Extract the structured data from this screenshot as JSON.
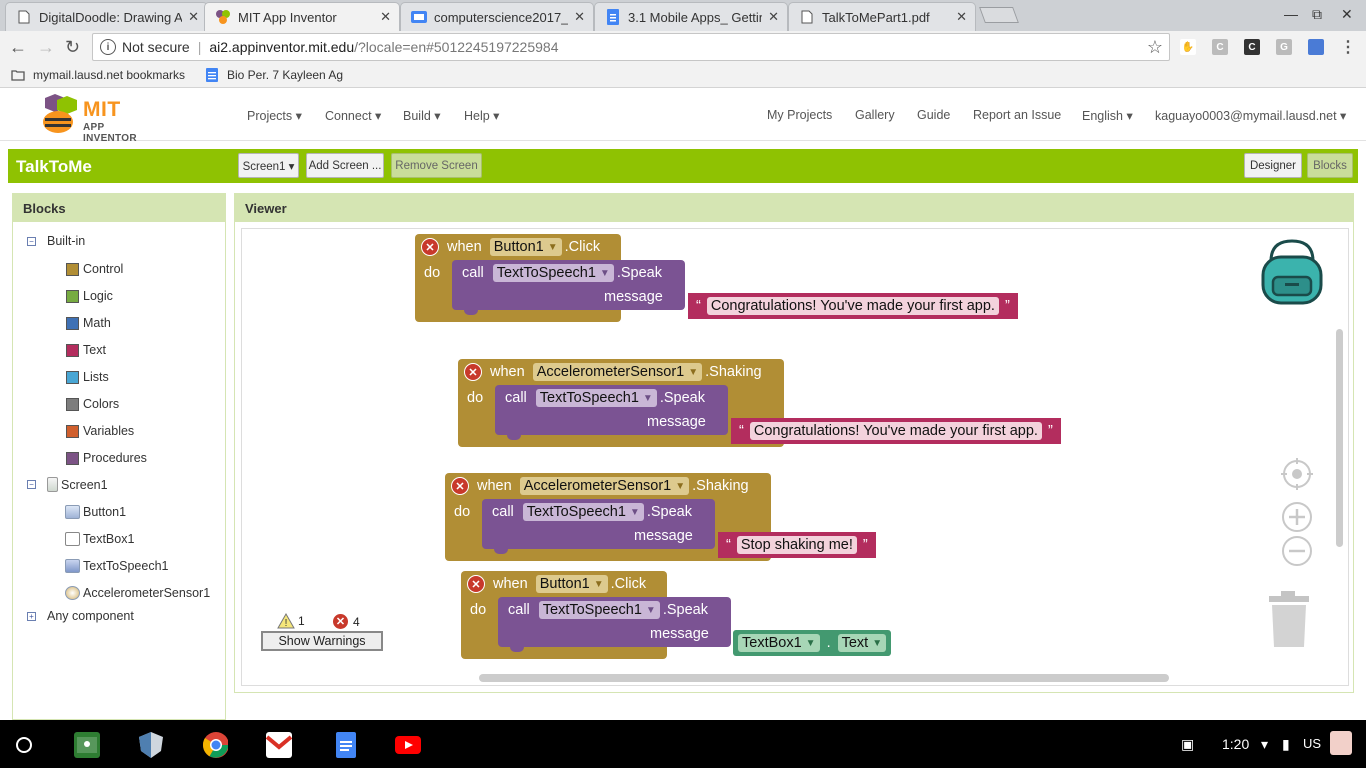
{
  "browser": {
    "tabs": [
      {
        "title": "DigitalDoodle: Drawing A",
        "active": false
      },
      {
        "title": "MIT App Inventor",
        "active": true
      },
      {
        "title": "computerscience2017_",
        "active": false
      },
      {
        "title": "3.1 Mobile Apps_ Getting",
        "active": false
      },
      {
        "title": "TalkToMePart1.pdf",
        "active": false
      }
    ],
    "close_glyph": "✕",
    "security_label": "Not secure",
    "url_host": "ai2.appinventor.mit.edu",
    "url_rest": "/?locale=en#5012245197225984",
    "bookmarks": [
      {
        "label": "mymail.lausd.net bookmarks"
      },
      {
        "label": "Bio Per. 7 Kayleen Ag"
      }
    ]
  },
  "header": {
    "logo_mit": "MIT",
    "logo_sub": "APP INVENTOR",
    "menus": [
      "Projects ▾",
      "Connect ▾",
      "Build ▾",
      "Help ▾"
    ],
    "right_links": [
      "My Projects",
      "Gallery",
      "Guide",
      "Report an Issue",
      "English ▾",
      "kaguayo0003@mymail.lausd.net ▾"
    ]
  },
  "project_bar": {
    "title": "TalkToMe",
    "screen_select": "Screen1 ▾",
    "add_screen": "Add Screen ...",
    "remove_screen": "Remove Screen",
    "designer": "Designer",
    "blocks": "Blocks"
  },
  "blocks_panel": {
    "title": "Blocks",
    "builtin_label": "Built-in",
    "builtin": [
      {
        "label": "Control",
        "color": "#b18e35"
      },
      {
        "label": "Logic",
        "color": "#77ab41"
      },
      {
        "label": "Math",
        "color": "#3f71b5"
      },
      {
        "label": "Text",
        "color": "#b32d5e"
      },
      {
        "label": "Lists",
        "color": "#49a6d4"
      },
      {
        "label": "Colors",
        "color": "#7d7d7d"
      },
      {
        "label": "Variables",
        "color": "#d05f2d"
      },
      {
        "label": "Procedures",
        "color": "#7c5385"
      }
    ],
    "screen_label": "Screen1",
    "components": [
      "Button1",
      "TextBox1",
      "TextToSpeech1",
      "AccelerometerSensor1"
    ],
    "any_component": "Any component"
  },
  "viewer": {
    "title": "Viewer",
    "warnings_count": "1",
    "errors_count": "4",
    "show_warnings": "Show Warnings"
  },
  "blocks": [
    {
      "when": "when",
      "component": "Button1",
      "event": ".Click",
      "do": "do",
      "call": "call",
      "target": "TextToSpeech1",
      "method": ".Speak",
      "message_label": "message",
      "quote": "“",
      "quote_end": "”",
      "message": "Congratulations! You've made your first app."
    },
    {
      "when": "when",
      "component": "AccelerometerSensor1",
      "event": ".Shaking",
      "do": "do",
      "call": "call",
      "target": "TextToSpeech1",
      "method": ".Speak",
      "message_label": "message",
      "quote": "“",
      "quote_end": "”",
      "message": "Congratulations! You've made your first app."
    },
    {
      "when": "when",
      "component": "AccelerometerSensor1",
      "event": ".Shaking",
      "do": "do",
      "call": "call",
      "target": "TextToSpeech1",
      "method": ".Speak",
      "message_label": "message",
      "quote": "“",
      "quote_end": "”",
      "message": "Stop shaking me!"
    },
    {
      "when": "when",
      "component": "Button1",
      "event": ".Click",
      "do": "do",
      "call": "call",
      "target": "TextToSpeech1",
      "method": ".Speak",
      "message_label": "message",
      "value_component": "TextBox1",
      "dot": ".",
      "value_prop": "Text"
    }
  ],
  "taskbar": {
    "time": "1:20",
    "locale": "US"
  },
  "colors": {
    "app_green": "#8fc202",
    "panel_green": "#d5e5b3",
    "control_block": "#b18e35",
    "procedure_block": "#7b5393",
    "text_block": "#b32d5e",
    "component_block": "#439970"
  }
}
